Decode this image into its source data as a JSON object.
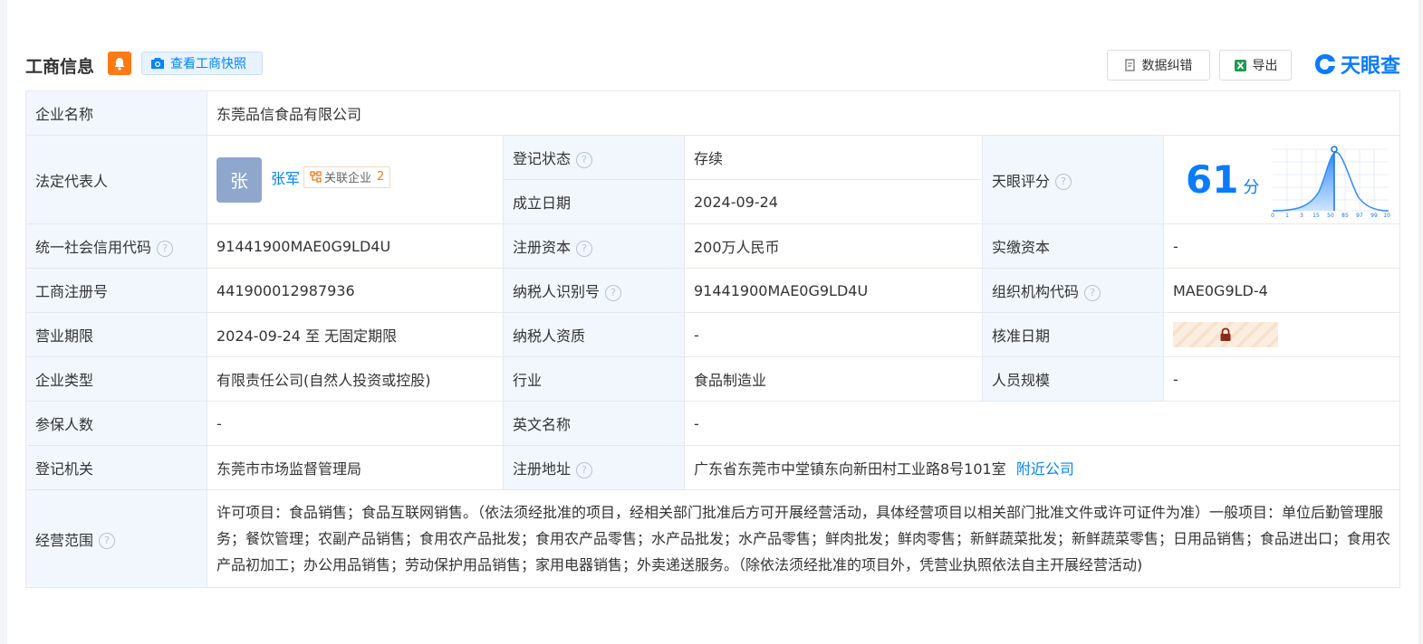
{
  "header": {
    "title": "工商信息",
    "snapshot_label": "查看工商快照",
    "data_correct_label": "数据纠错",
    "export_label": "导出",
    "logo_text": "天眼查"
  },
  "company": {
    "name_label": "企业名称",
    "name": "东莞品信食品有限公司",
    "legal_rep_label": "法定代表人",
    "legal_rep_avatar": "张",
    "legal_rep_name": "张军",
    "related_label": "关联企业",
    "related_count": "2",
    "reg_status_label": "登记状态",
    "reg_status": "存续",
    "est_date_label": "成立日期",
    "est_date": "2024-09-24",
    "score_label": "天眼评分",
    "score_value": "61",
    "score_unit": "分",
    "score_ticks": [
      "0",
      "1",
      "3",
      "15",
      "50",
      "85",
      "97",
      "99",
      "100"
    ],
    "credit_code_label": "统一社会信用代码",
    "credit_code": "91441900MAE0G9LD4U",
    "reg_capital_label": "注册资本",
    "reg_capital": "200万人民币",
    "paid_capital_label": "实缴资本",
    "paid_capital": "-",
    "reg_no_label": "工商注册号",
    "reg_no": "441900012987936",
    "taxpayer_id_label": "纳税人识别号",
    "taxpayer_id": "91441900MAE0G9LD4U",
    "org_code_label": "组织机构代码",
    "org_code": "MAE0G9LD-4",
    "term_label": "营业期限",
    "term": "2024-09-24 至 无固定期限",
    "taxpayer_qual_label": "纳税人资质",
    "taxpayer_qual": "-",
    "approval_date_label": "核准日期",
    "type_label": "企业类型",
    "type": "有限责任公司(自然人投资或控股)",
    "industry_label": "行业",
    "industry": "食品制造业",
    "staff_label": "人员规模",
    "staff": "-",
    "insured_label": "参保人数",
    "insured": "-",
    "english_name_label": "英文名称",
    "english_name": "-",
    "authority_label": "登记机关",
    "authority": "东莞市市场监督管理局",
    "address_label": "注册地址",
    "address": "广东省东莞市中堂镇东向新田村工业路8号101室",
    "nearby_label": "附近公司",
    "scope_label": "经营范围",
    "scope": "许可项目：食品销售；食品互联网销售。（依法须经批准的项目，经相关部门批准后方可开展经营活动，具体经营项目以相关部门批准文件或许可证件为准）一般项目：单位后勤管理服务；餐饮管理；农副产品销售；食用农产品批发；食用农产品零售；水产品批发；水产品零售；鲜肉批发；鲜肉零售；新鲜蔬菜批发；新鲜蔬菜零售；日用品销售；食品进出口；食用农产品初加工；办公用品销售；劳动保护用品销售；家用电器销售；外卖递送服务。（除依法须经批准的项目外，凭营业执照依法自主开展经营活动)"
  },
  "colors": {
    "accent": "#0084ff",
    "status_green": "#13a36a",
    "label_bg": "#f1f7fd",
    "bell": "#ff7a14"
  }
}
